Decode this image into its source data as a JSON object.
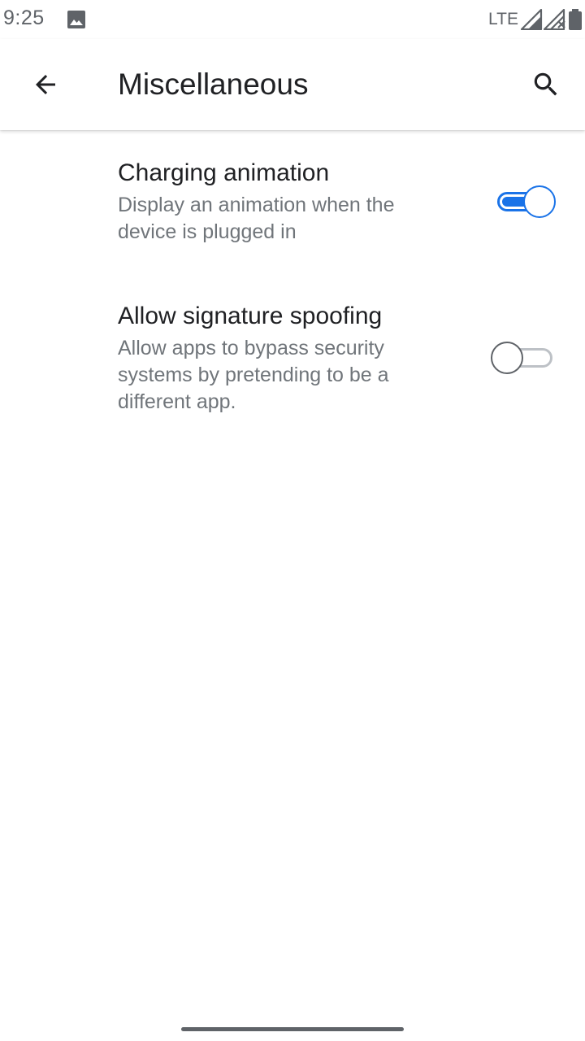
{
  "status_bar": {
    "time": "9:25",
    "network": "LTE",
    "icons": [
      "image-icon",
      "signal-icon",
      "signal-no-data-icon",
      "battery-icon"
    ]
  },
  "app_bar": {
    "title": "Miscellaneous",
    "back_icon": "arrow-back-icon",
    "search_icon": "search-icon"
  },
  "settings": [
    {
      "title": "Charging animation",
      "summary": "Display an animation when the device is plugged in",
      "enabled": true
    },
    {
      "title": "Allow signature spoofing",
      "summary": "Allow apps to bypass security systems by pretending to be a different app.",
      "enabled": false
    }
  ],
  "colors": {
    "accent": "#1a73e8",
    "primary_text": "#202124",
    "secondary_text": "#70757a",
    "switch_off_track": "#bdc1c6"
  }
}
